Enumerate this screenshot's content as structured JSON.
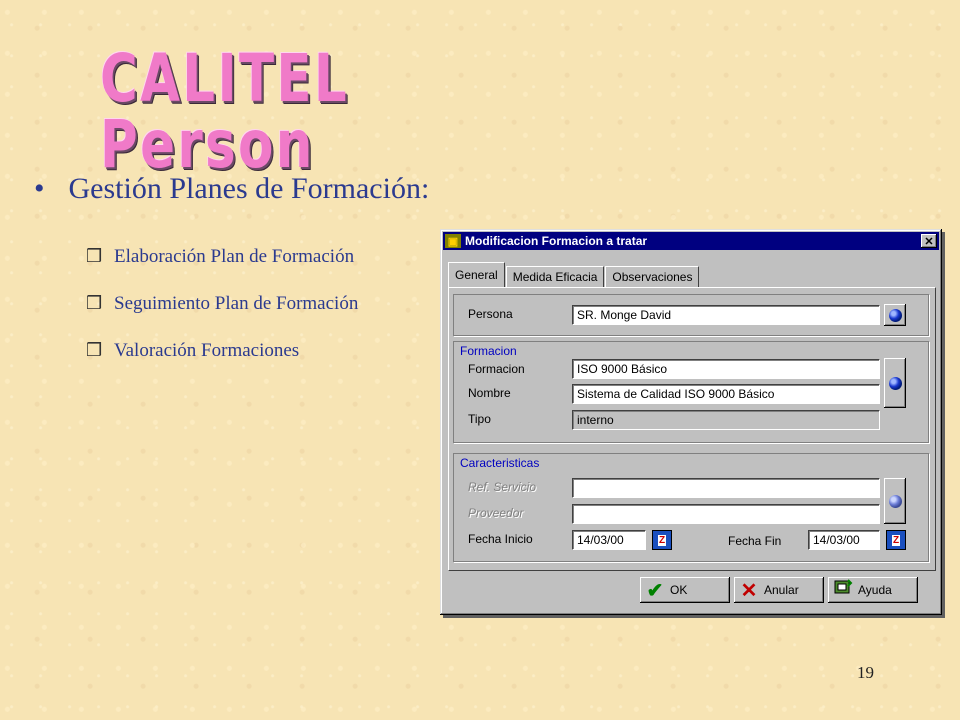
{
  "slide": {
    "title": "CALITEL Person",
    "main_bullet": "Gestión Planes de Formación:",
    "sub_bullets": [
      "Elaboración Plan de Formación",
      "Seguimiento Plan de Formación",
      "Valoración Formaciones"
    ],
    "page_number": "19"
  },
  "icons": {
    "main_bullet": "•",
    "sub_bullet": "❒",
    "close": "✕",
    "ok": "✔",
    "cancel": "✕",
    "help": "help-icon"
  },
  "dialog": {
    "title": "Modificacion Formacion a tratar",
    "tabs": [
      "General",
      "Medida Eficacia",
      "Observaciones"
    ],
    "active_tab": "General",
    "persona": {
      "label": "Persona",
      "value": "SR. Monge David"
    },
    "formacion_group": {
      "title": "Formacion",
      "formacion": {
        "label": "Formacion",
        "value": "ISO 9000 Básico"
      },
      "nombre": {
        "label": "Nombre",
        "value": "Sistema de Calidad ISO 9000 Básico"
      },
      "tipo": {
        "label": "Tipo",
        "value": "interno"
      }
    },
    "caracteristicas_group": {
      "title": "Caracteristicas",
      "ref_servicio": {
        "label": "Ref. Servicio",
        "value": ""
      },
      "proveedor": {
        "label": "Proveedor",
        "value": ""
      },
      "fecha_inicio": {
        "label": "Fecha Inicio",
        "value": "14/03/00"
      },
      "fecha_fin": {
        "label": "Fecha Fin",
        "value": "14/03/00"
      }
    },
    "buttons": {
      "ok": "OK",
      "anular": "Anular",
      "ayuda": "Ayuda"
    },
    "calendar_icon_text": "Z"
  },
  "colors": {
    "background": "#f7e4b4",
    "title_pink": "#f07ac8",
    "text_blue": "#2b3a8f",
    "titlebar": "#000080",
    "group_title": "#0000c0"
  }
}
